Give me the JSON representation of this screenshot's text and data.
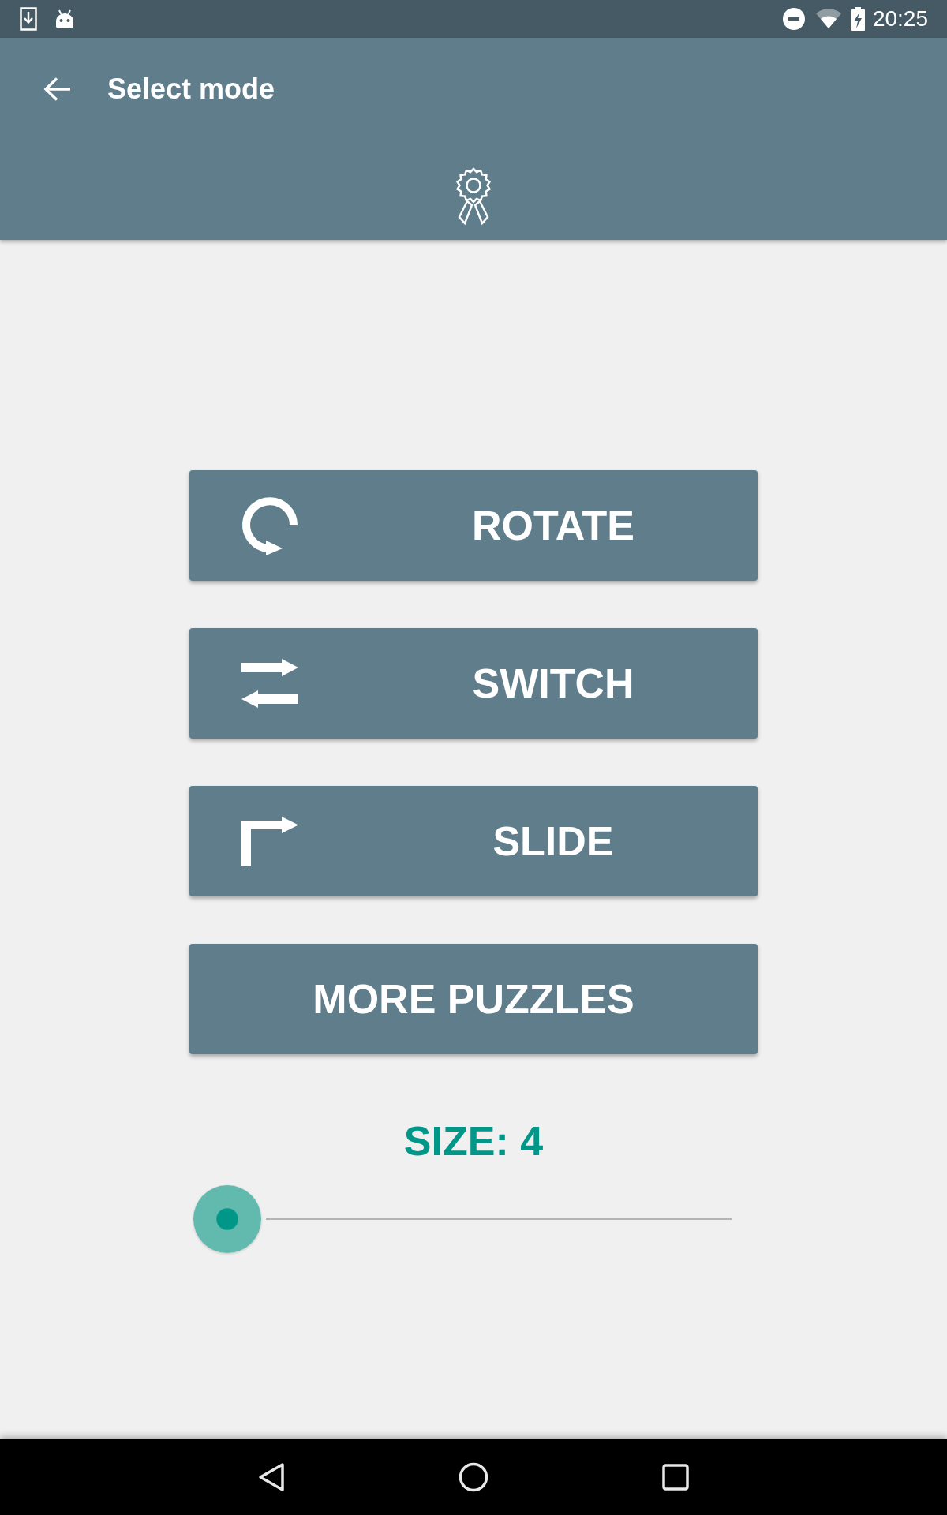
{
  "status_bar": {
    "time": "20:25"
  },
  "toolbar": {
    "title": "Select mode"
  },
  "mode_buttons": [
    {
      "label": "ROTATE",
      "kind": "rotate"
    },
    {
      "label": "SWITCH",
      "kind": "switch"
    },
    {
      "label": "SLIDE",
      "kind": "slide"
    },
    {
      "label": "MORE PUZZLES",
      "kind": "plain"
    }
  ],
  "size": {
    "label": "SIZE: 4",
    "level": 0
  }
}
